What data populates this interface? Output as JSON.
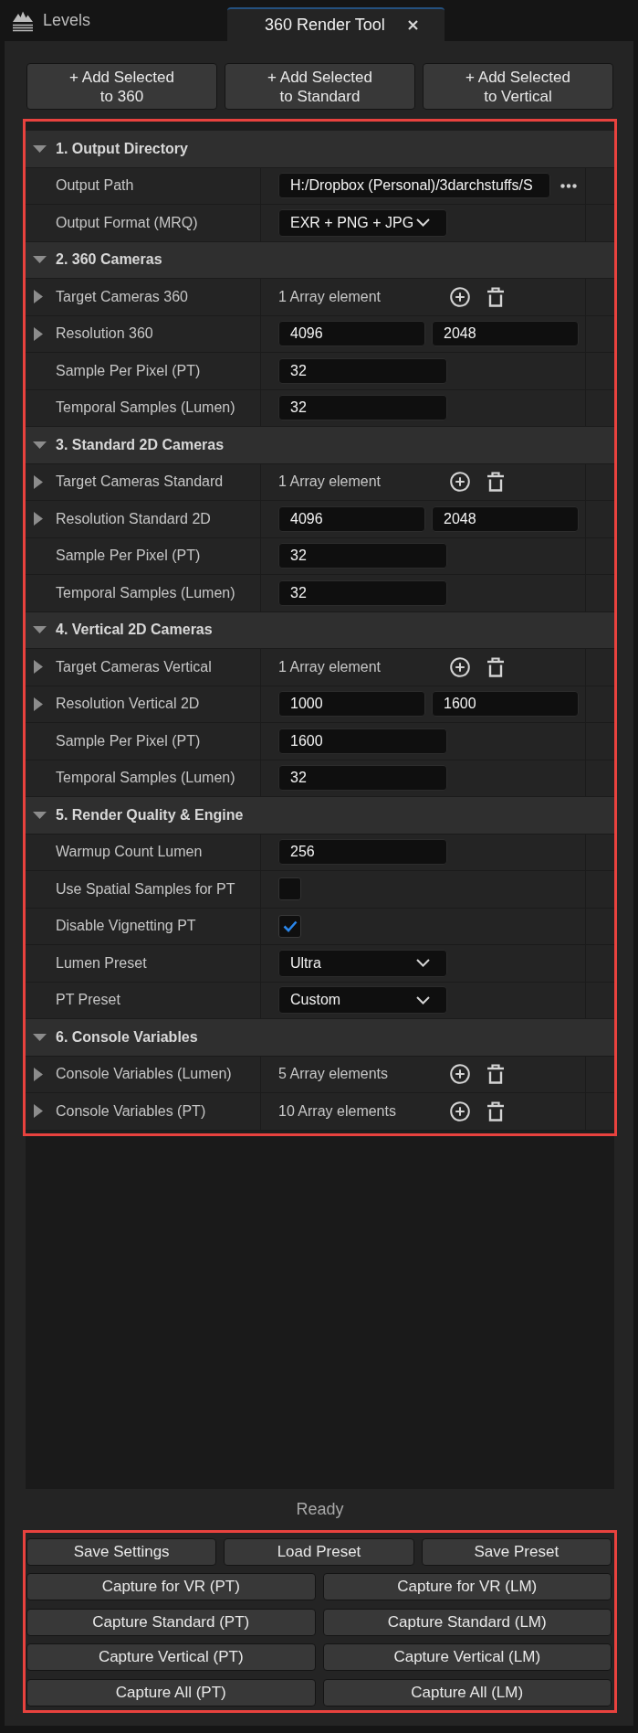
{
  "tabs": [
    {
      "label": "Levels",
      "kind": "levels",
      "selected": false,
      "closable": false
    },
    {
      "label": "360 Render Tool",
      "kind": "tool",
      "selected": true,
      "closable": true
    }
  ],
  "add_buttons": [
    {
      "label": "+ Add Selected\nto 360"
    },
    {
      "label": "+ Add Selected\nto Standard"
    },
    {
      "label": "+ Add Selected\nto Vertical"
    }
  ],
  "properties": {
    "highlighted": true,
    "sections": [
      {
        "title": "1. Output Directory",
        "expanded": true,
        "rows": [
          {
            "label": "Output Path",
            "kind": "path",
            "value": "H:/Dropbox (Personal)/3darchstuffs/S"
          },
          {
            "label": "Output Format (MRQ)",
            "kind": "dropdown",
            "value": "EXR + PNG + JPG"
          }
        ]
      },
      {
        "title": "2. 360 Cameras",
        "expanded": true,
        "rows": [
          {
            "label": "Target Cameras 360",
            "kind": "array",
            "expanded": false,
            "value": "1 Array element"
          },
          {
            "label": "Resolution 360",
            "kind": "vector",
            "expanded": false,
            "values": [
              "4096",
              "2048"
            ]
          },
          {
            "label": "Sample Per Pixel (PT)",
            "kind": "number",
            "value": "32"
          },
          {
            "label": "Temporal Samples (Lumen)",
            "kind": "number",
            "value": "32"
          }
        ]
      },
      {
        "title": "3. Standard 2D Cameras",
        "expanded": true,
        "rows": [
          {
            "label": "Target Cameras Standard",
            "kind": "array",
            "expanded": false,
            "value": "1 Array element"
          },
          {
            "label": "Resolution Standard 2D",
            "kind": "vector",
            "expanded": false,
            "values": [
              "4096",
              "2048"
            ]
          },
          {
            "label": "Sample Per Pixel (PT)",
            "kind": "number",
            "value": "32"
          },
          {
            "label": "Temporal Samples (Lumen)",
            "kind": "number",
            "value": "32"
          }
        ]
      },
      {
        "title": "4. Vertical 2D Cameras",
        "expanded": true,
        "rows": [
          {
            "label": "Target Cameras Vertical",
            "kind": "array",
            "expanded": false,
            "value": "1 Array element"
          },
          {
            "label": "Resolution Vertical 2D",
            "kind": "vector",
            "expanded": false,
            "values": [
              "1000",
              "1600"
            ]
          },
          {
            "label": "Sample Per Pixel (PT)",
            "kind": "number",
            "value": "1600"
          },
          {
            "label": "Temporal Samples (Lumen)",
            "kind": "number",
            "value": "32"
          }
        ]
      },
      {
        "title": "5. Render Quality & Engine",
        "expanded": true,
        "rows": [
          {
            "label": "Warmup Count Lumen",
            "kind": "number",
            "value": "256"
          },
          {
            "label": "Use Spatial Samples for PT",
            "kind": "checkbox",
            "checked": false
          },
          {
            "label": "Disable Vignetting PT",
            "kind": "checkbox",
            "checked": true
          },
          {
            "label": "Lumen Preset",
            "kind": "dropdown",
            "value": "Ultra"
          },
          {
            "label": "PT Preset",
            "kind": "dropdown",
            "value": "Custom"
          }
        ]
      },
      {
        "title": "6. Console Variables",
        "expanded": true,
        "rows": [
          {
            "label": "Console Variables (Lumen)",
            "kind": "array",
            "expanded": false,
            "value": "5 Array elements"
          },
          {
            "label": "Console Variables (PT)",
            "kind": "array",
            "expanded": false,
            "value": "10 Array elements"
          }
        ]
      }
    ]
  },
  "status": "Ready",
  "actions": {
    "highlighted": true,
    "rows": [
      [
        "Save Settings",
        "Load Preset",
        "Save Preset"
      ],
      [
        "Capture for VR (PT)",
        "Capture for VR (LM)"
      ],
      [
        "Capture Standard (PT)",
        "Capture Standard (LM)"
      ],
      [
        "Capture Vertical (PT)",
        "Capture Vertical (LM)"
      ],
      [
        "Capture All (PT)",
        "Capture All (LM)"
      ]
    ]
  }
}
